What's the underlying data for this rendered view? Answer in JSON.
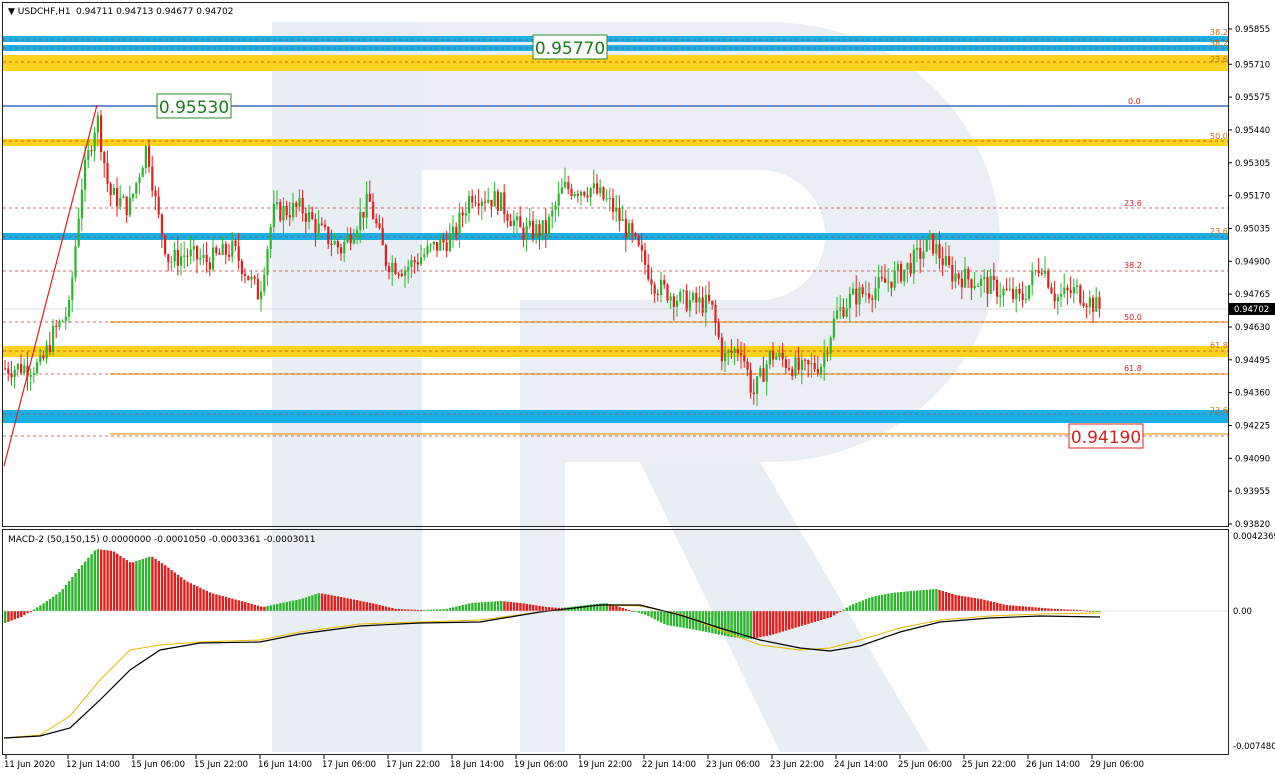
{
  "header": {
    "symbol": "USDCHF,H1",
    "ohlc": "0.94711 0.94713 0.94677 0.94702"
  },
  "macd_header": "MACD-2 (50,150,15) 0.0000000 -0.0001050 -0.0003361 -0.0003011",
  "price_axis": [
    "0.95855",
    "0.95710",
    "0.95575",
    "0.95440",
    "0.95305",
    "0.95170",
    "0.95035",
    "0.94900",
    "0.94765",
    "0.94630",
    "0.94495",
    "0.94360",
    "0.94225",
    "0.94090",
    "0.93955",
    "0.93820"
  ],
  "macd_axis": [
    "0.0042369",
    "0.00",
    "-0.0074801"
  ],
  "time_axis": [
    "11 Jun 2020",
    "12 Jun 14:00",
    "15 Jun 06:00",
    "15 Jun 22:00",
    "16 Jun 14:00",
    "17 Jun 06:00",
    "17 Jun 22:00",
    "18 Jun 14:00",
    "19 Jun 06:00",
    "19 Jun 22:00",
    "22 Jun 14:00",
    "23 Jun 06:00",
    "23 Jun 22:00",
    "24 Jun 14:00",
    "25 Jun 06:00",
    "25 Jun 22:00",
    "26 Jun 14:00",
    "29 Jun 06:00"
  ],
  "callouts": {
    "top": "0.95770",
    "high": "0.95530",
    "target": "0.94190"
  },
  "current_price": "0.94702",
  "fib_labels_right": {
    "a": "38.2",
    "b": "38.2",
    "c": "23.6",
    "d": "50.0",
    "e": "23.6",
    "f": "61.8",
    "g": "23.6"
  },
  "fib_labels_inner": {
    "a": "0.0",
    "b": "23.6",
    "c": "38.2",
    "d": "50.0",
    "e": "61.8"
  },
  "colors": {
    "bull": "#2db52d",
    "bear": "#e0201c",
    "blue_zone": "#1ab0e6",
    "yellow_zone": "#ffd21f",
    "fib_red": "#e03030",
    "orange_line": "#f0a020"
  },
  "chart_data": {
    "type": "candlestick",
    "symbol": "USDCHF",
    "timeframe": "H1",
    "x_range": [
      "11 Jun 2020",
      "29 Jun 06:00"
    ],
    "y_range": [
      0.9382,
      0.95855
    ],
    "key_levels": [
      0.9577,
      0.9553,
      0.9419
    ],
    "last_close": 0.94702,
    "indicator": {
      "name": "MACD-2",
      "params": [
        50,
        150,
        15
      ],
      "values": [
        0.0,
        -0.000105,
        -0.0003361,
        -0.0003011
      ],
      "y_range": [
        -0.0074801,
        0.0042369
      ]
    }
  }
}
